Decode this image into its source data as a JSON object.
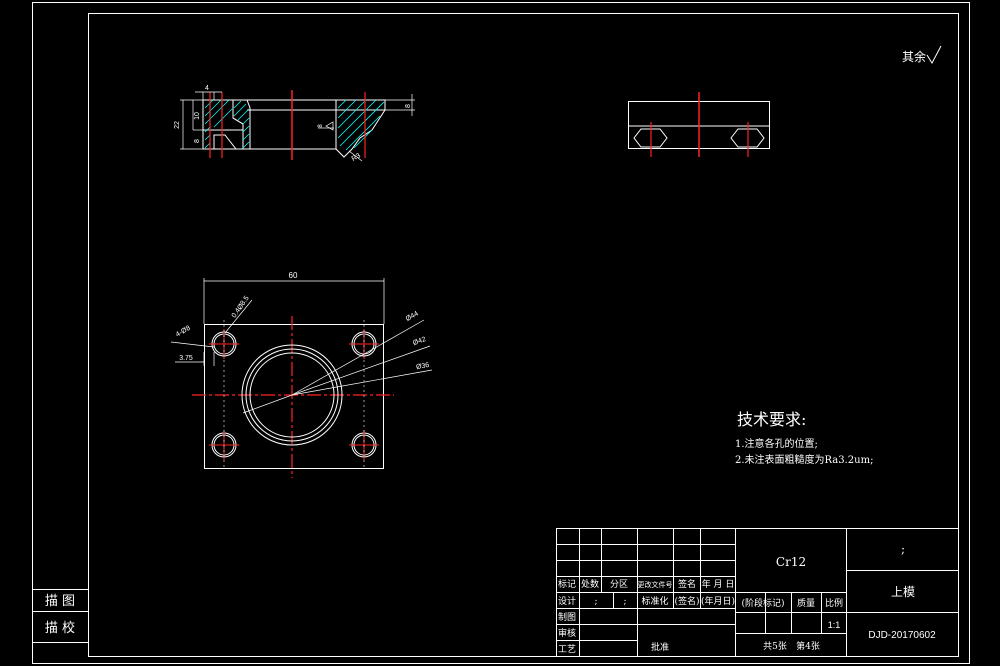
{
  "general_roughness": "其余",
  "tech_req": {
    "title": "技术要求:",
    "items": [
      "1.注意各孔的位置;",
      "2.未注表面粗糙度为Ra3.2um;"
    ]
  },
  "side_block": {
    "trace": "描 图",
    "check": "描 校"
  },
  "dims": {
    "width_60": "60",
    "dia_44": "Ø44",
    "dia_42": "Ø42",
    "dia_36": "Ø36",
    "holes": "4-Ø8",
    "chamfer": "0.4Ø8.5",
    "offset": "3.75",
    "h4": "4",
    "h10": "10",
    "h22": "22",
    "h8": "8",
    "h8b": "8",
    "r": "R3",
    "roughness": "8"
  },
  "title_block": {
    "material": "Cr12",
    "part_name": "上模",
    "semicolon": ";",
    "drawing_no": "DJD-20170602",
    "scale": "1:1",
    "sheets": "共5张",
    "sheet_no": "第4张",
    "hdr": [
      "标记",
      "处数",
      "分区",
      "更改文件号",
      "签名",
      "年 月 日"
    ],
    "design": "设计",
    "design_semi1": ";",
    "design_semi2": ";",
    "standard": "标准化",
    "sign": "(签名)",
    "date": "(年月日)",
    "stage": "(阶段标记)",
    "weight": "质量",
    "ratio": "比例",
    "drafting": "制图",
    "review": "审核",
    "process": "工艺",
    "approve": "批准"
  }
}
